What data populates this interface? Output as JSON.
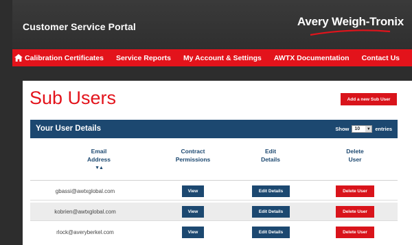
{
  "header": {
    "portal_title": "Customer Service Portal",
    "brand": "Avery Weigh-Tronix"
  },
  "nav": {
    "home_icon": "home-icon",
    "items": [
      "Calibration Certificates",
      "Service Reports",
      "My Account & Settings",
      "AWTX Documentation",
      "Contact Us"
    ]
  },
  "page": {
    "title": "Sub Users",
    "add_button": "Add a new Sub User"
  },
  "panel": {
    "title": "Your User Details",
    "show_label": "Show",
    "entries_value": "10",
    "entries_label": "entries"
  },
  "columns": [
    {
      "line1": "Email",
      "line2": "Address"
    },
    {
      "line1": "Contract",
      "line2": "Permissions"
    },
    {
      "line1": "Edit",
      "line2": "Details"
    },
    {
      "line1": "Delete",
      "line2": "User"
    }
  ],
  "sort_icon": "▼▲",
  "rows": [
    {
      "email": "gbassi@awtxglobal.com",
      "view": "View",
      "edit": "Edit Details",
      "delete": "Delete User"
    },
    {
      "email": "kobrien@awtxglobal.com",
      "view": "View",
      "edit": "Edit Details",
      "delete": "Delete User"
    },
    {
      "email": "rlock@averyberkel.com",
      "view": "View",
      "edit": "Edit Details",
      "delete": "Delete User"
    }
  ],
  "colors": {
    "brand_red": "#e3131b",
    "navy": "#1c4870",
    "header_bg": "#333333"
  }
}
